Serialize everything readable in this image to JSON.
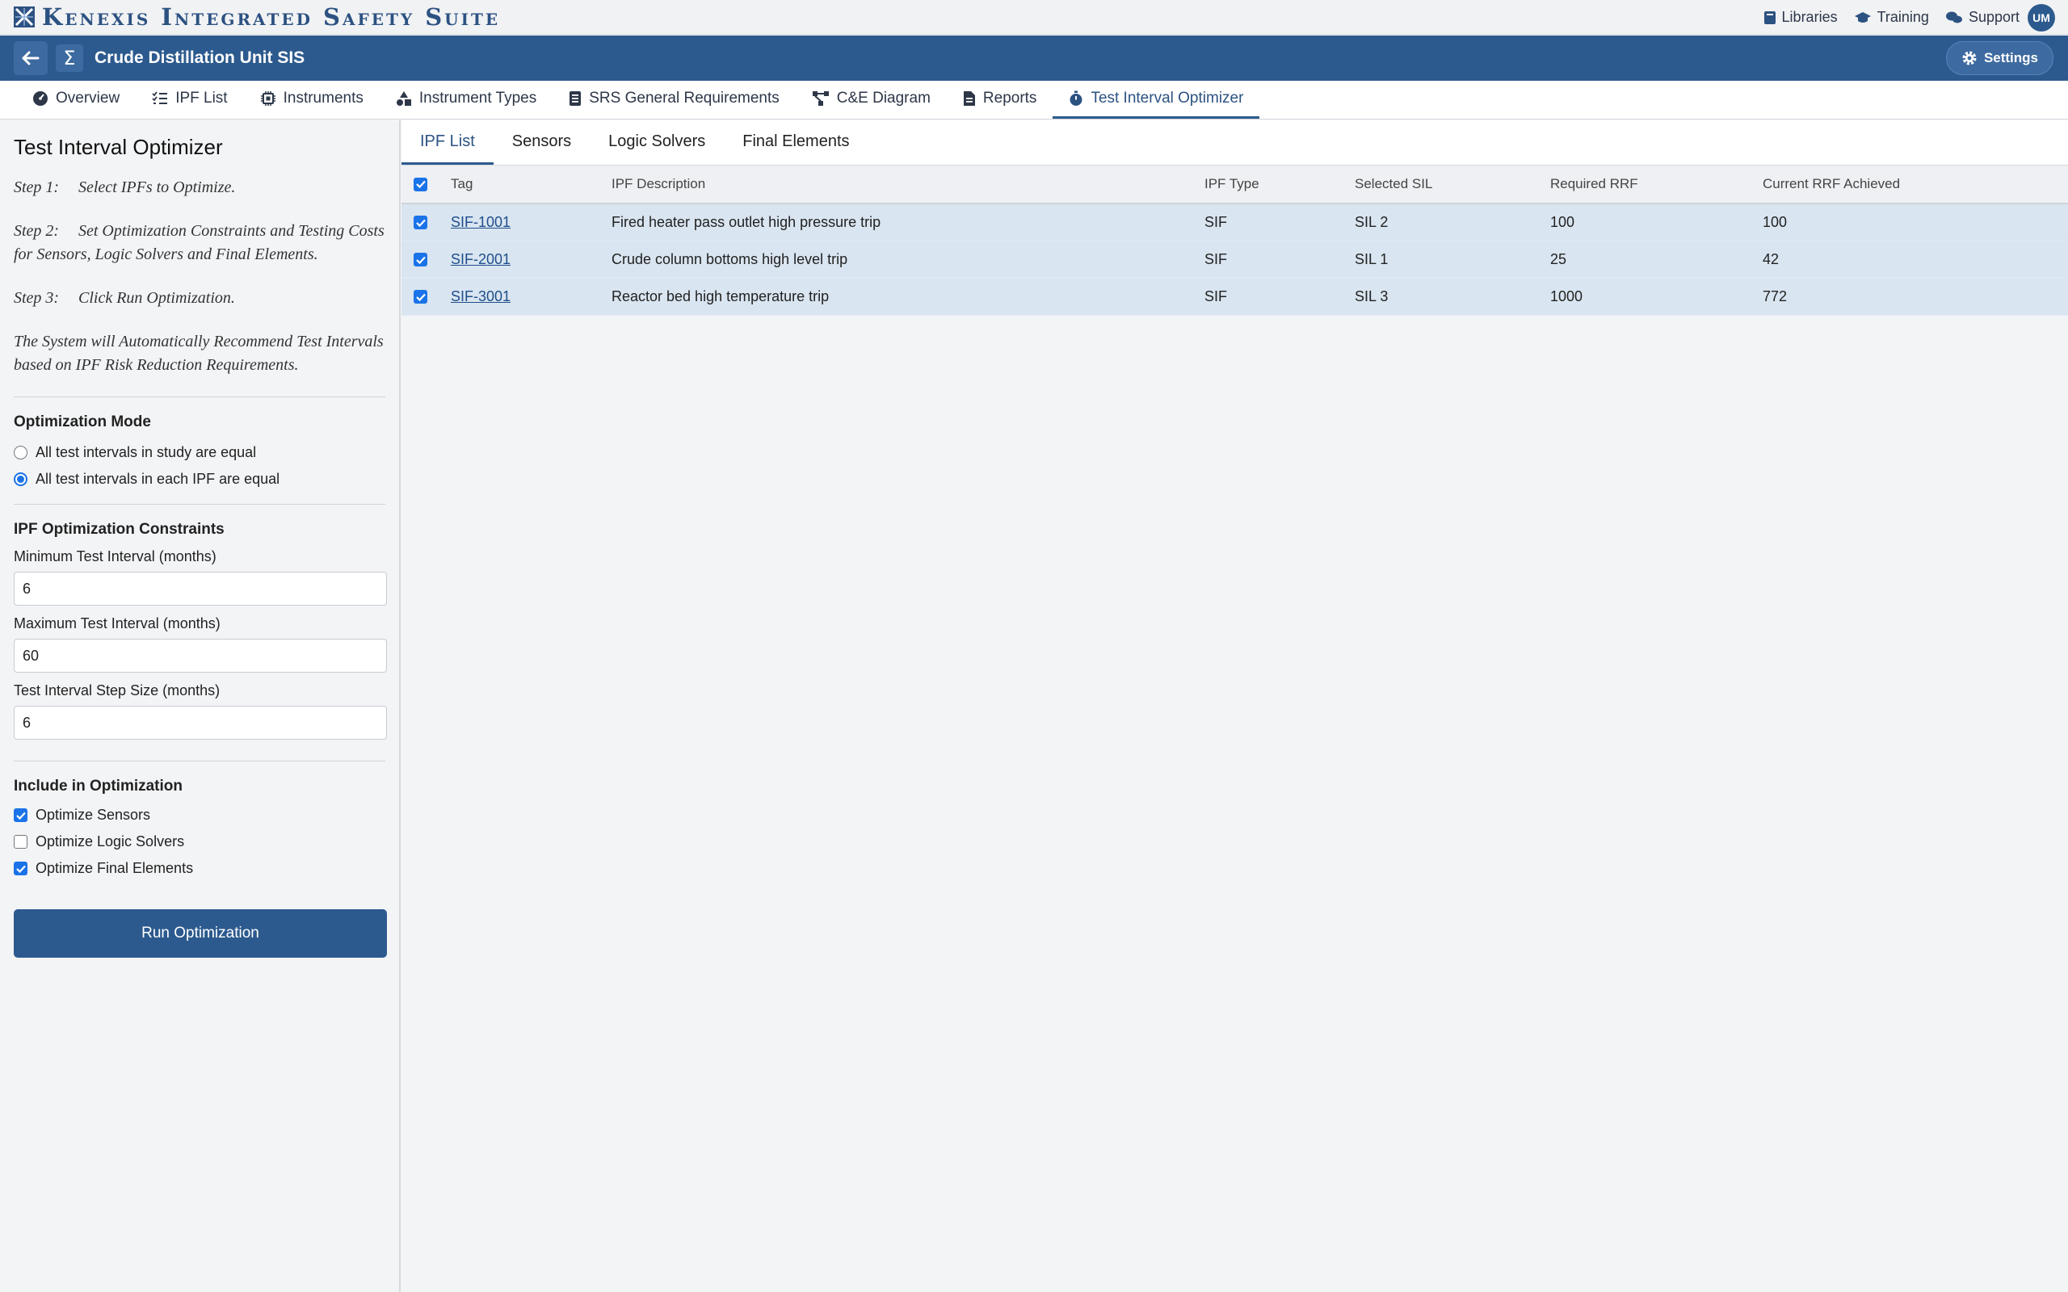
{
  "app": {
    "brand": "Kenexis Integrated Safety Suite",
    "top_links": [
      {
        "label": "Libraries",
        "icon": "book-icon"
      },
      {
        "label": "Training",
        "icon": "graduation-cap-icon"
      },
      {
        "label": "Support",
        "icon": "chat-icon"
      }
    ],
    "user_initials": "UM"
  },
  "project": {
    "title": "Crude Distillation Unit SIS",
    "settings_label": "Settings"
  },
  "nav": {
    "tabs": [
      {
        "label": "Overview",
        "icon": "gauge-icon"
      },
      {
        "label": "IPF List",
        "icon": "list-icon"
      },
      {
        "label": "Instruments",
        "icon": "chip-icon"
      },
      {
        "label": "Instrument Types",
        "icon": "shapes-icon"
      },
      {
        "label": "SRS General Requirements",
        "icon": "document-list-icon"
      },
      {
        "label": "C&E Diagram",
        "icon": "diagram-icon"
      },
      {
        "label": "Reports",
        "icon": "report-icon"
      },
      {
        "label": "Test Interval Optimizer",
        "icon": "stopwatch-icon",
        "active": true
      }
    ]
  },
  "left": {
    "title": "Test Interval Optimizer",
    "steps": [
      {
        "head": "Step 1:",
        "text": "Select IPFs to Optimize."
      },
      {
        "head": "Step 2:",
        "text": "Set Optimization Constraints and Testing Costs for Sensors, Logic Solvers and Final Elements."
      },
      {
        "head": "Step 3:",
        "text": "Click Run Optimization."
      }
    ],
    "note": "The System will Automatically Recommend Test Intervals based on IPF Risk Reduction Requirements.",
    "mode": {
      "title": "Optimization Mode",
      "options": [
        {
          "label": "All test intervals in study are equal",
          "selected": false
        },
        {
          "label": "All test intervals in each IPF are equal",
          "selected": true
        }
      ]
    },
    "constraints": {
      "title": "IPF Optimization Constraints",
      "min_label": "Minimum Test Interval (months)",
      "min_value": "6",
      "max_label": "Maximum Test Interval (months)",
      "max_value": "60",
      "step_label": "Test Interval Step Size (months)",
      "step_value": "6"
    },
    "include": {
      "title": "Include in Optimization",
      "items": [
        {
          "label": "Optimize Sensors",
          "checked": true
        },
        {
          "label": "Optimize Logic Solvers",
          "checked": false
        },
        {
          "label": "Optimize Final Elements",
          "checked": true
        }
      ]
    },
    "run_label": "Run Optimization"
  },
  "subtabs": [
    {
      "label": "IPF List",
      "active": true
    },
    {
      "label": "Sensors"
    },
    {
      "label": "Logic Solvers"
    },
    {
      "label": "Final Elements"
    }
  ],
  "table": {
    "headers": [
      "Tag",
      "IPF Description",
      "IPF Type",
      "Selected SIL",
      "Required RRF",
      "Current RRF Achieved"
    ],
    "rows": [
      {
        "tag": "SIF-1001",
        "desc": "Fired heater pass outlet high pressure trip",
        "type": "SIF",
        "sil": "SIL 2",
        "req": "100",
        "cur": "100",
        "checked": true
      },
      {
        "tag": "SIF-2001",
        "desc": "Crude column bottoms high level trip",
        "type": "SIF",
        "sil": "SIL 1",
        "req": "25",
        "cur": "42",
        "checked": true
      },
      {
        "tag": "SIF-3001",
        "desc": "Reactor bed high temperature trip",
        "type": "SIF",
        "sil": "SIL 3",
        "req": "1000",
        "cur": "772",
        "checked": true
      }
    ]
  },
  "colors": {
    "primary": "#2c5a8e",
    "row_selected": "#d9e5f0",
    "checkbox": "#1a73e8"
  }
}
